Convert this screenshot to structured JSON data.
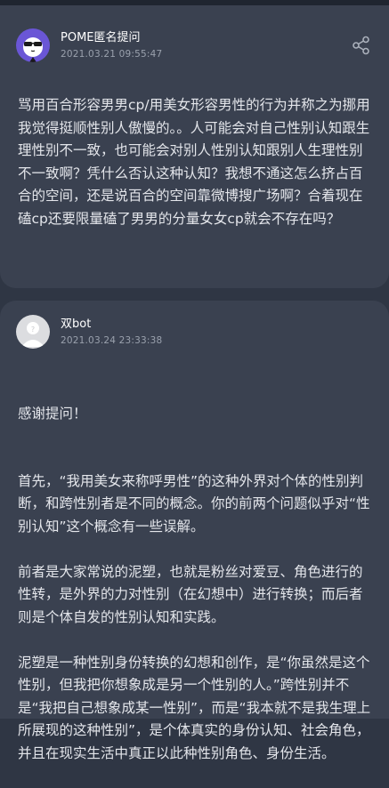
{
  "question": {
    "author": "POME匿名提问",
    "timestamp": "2021.03.21 09:55:47",
    "text": "骂用百合形容男男cp/用美女形容男性的行为并称之为挪用我觉得挺顺性别人傲慢的。。人可能会对自己性别认知跟生理性别不一致，也可能会对别人性别认知跟别人生理性别不一致啊？凭什么否认这种认知？我想不通这怎么挤占百合的空间，还是说百合的空间靠微博搜广场啊？合着现在磕cp还要限量磕了男男的分量女女cp就会不存在吗？"
  },
  "answer": {
    "author": "双bot",
    "timestamp": "2021.03.24 23:33:38",
    "greeting": "感谢提问！",
    "paragraphs": [
      "首先，“我用美女来称呼男性”的这种外界对个体的性别判断，和跨性别者是不同的概念。你的前两个问题似乎对“性别认知”这个概念有一些误解。",
      "前者是大家常说的泥塑，也就是粉丝对爱豆、角色进行的性转，是外界的力对性别（在幻想中）进行转换；而后者则是个体自发的性别认知和实践。",
      "泥塑是一种性别身份转换的幻想和创作，是“你虽然是这个性别，但我把你想象成是另一个性别的人。”跨性别并不是“我把自己想象成某一性别”，而是“我本就不是我生理上所展现的这种性别”，是个体真实的身份认知、社会角色，并且在现实生活中真正以此种性别角色、身份生活。"
    ]
  },
  "icons": {
    "share": "share-icon",
    "anonymous_avatar": "sunglasses-avatar-icon",
    "bot_avatar": "default-avatar-icon"
  },
  "colors": {
    "background": "#2f3644",
    "card": "#3a4150",
    "avatar_purple": "#6a56d6"
  }
}
